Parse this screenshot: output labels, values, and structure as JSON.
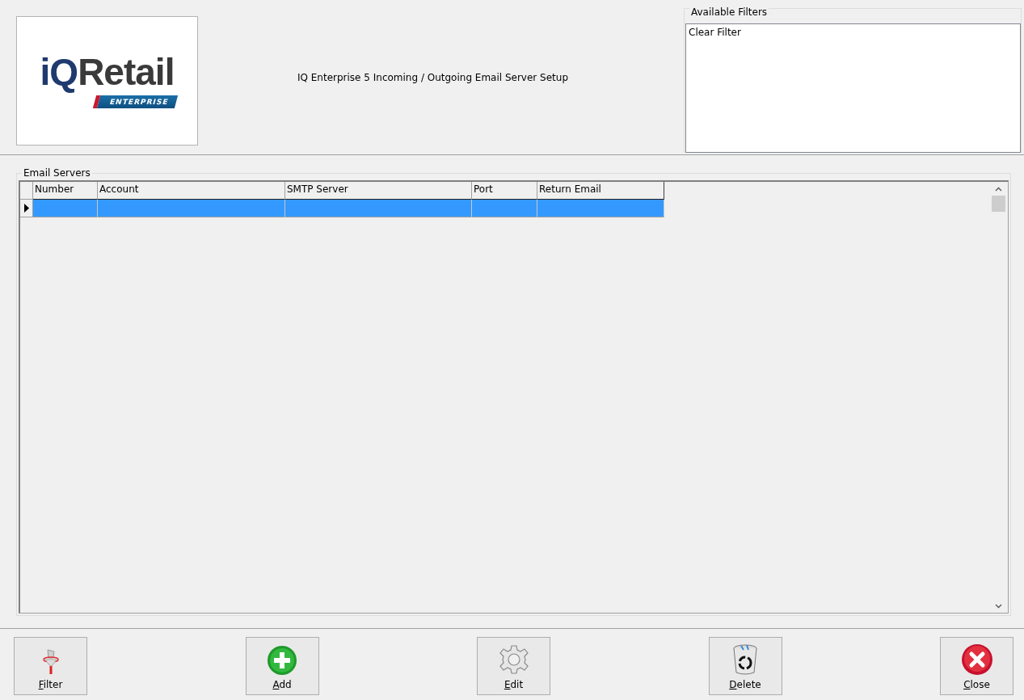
{
  "logo": {
    "brand_first": "iQ",
    "brand_rest": "Retail",
    "badge": "ENTERPRISE"
  },
  "title": "IQ Enterprise 5 Incoming / Outgoing Email Server Setup",
  "available_filters": {
    "label": "Available Filters",
    "items": [
      {
        "label": "Clear Filter",
        "selected": false
      }
    ]
  },
  "email_servers": {
    "label": "Email Servers",
    "columns": [
      "Number",
      "Account",
      "SMTP Server",
      "Port",
      "Return Email"
    ],
    "rows": [
      {
        "selected": true
      }
    ]
  },
  "buttons": [
    {
      "kind": "filter",
      "label": "Filter",
      "mnemonic": true
    },
    {
      "kind": "add",
      "label": "Add",
      "mnemonic": true
    },
    {
      "kind": "edit",
      "label": "Edit",
      "mnemonic": true
    },
    {
      "kind": "delete",
      "label": "Delete",
      "mnemonic": true
    },
    {
      "kind": "close",
      "label": "Close",
      "mnemonic": true
    }
  ]
}
